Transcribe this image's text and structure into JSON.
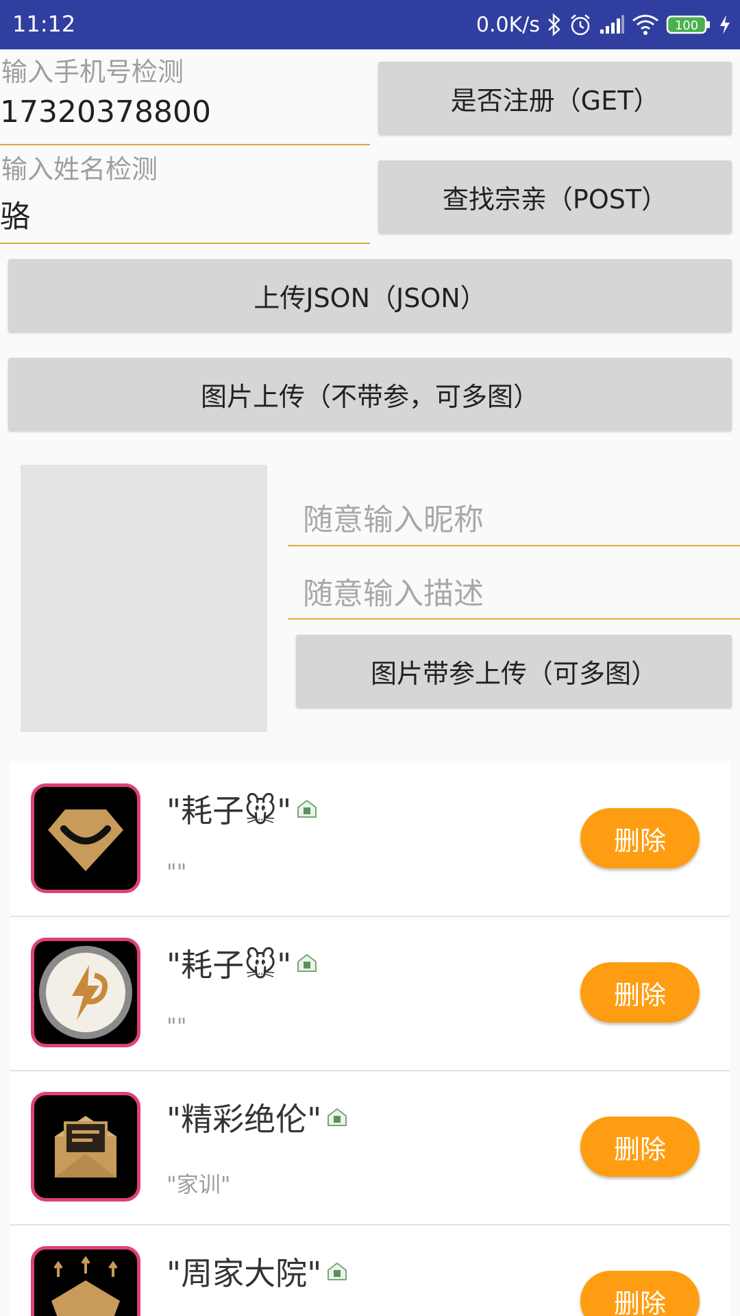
{
  "status": {
    "time": "11:12",
    "speed": "0.0K/s",
    "battery": "100"
  },
  "phone_field": {
    "label": "输入手机号检测",
    "value": "17320378800"
  },
  "name_field": {
    "label": "输入姓名检测",
    "value": "骆"
  },
  "buttons": {
    "register_check": "是否注册（GET）",
    "find_relatives": "查找宗亲（POST）",
    "upload_json": "上传JSON（JSON）",
    "image_upload": "图片上传（不带参，可多图）",
    "image_upload_params": "图片带参上传（可多图）"
  },
  "form": {
    "nickname_placeholder": "随意输入昵称",
    "description_placeholder": "随意输入描述"
  },
  "list": {
    "delete_label": "删除",
    "items": [
      {
        "name": "\"耗子🐭\"",
        "desc": "\"\"",
        "avatar_icon": "smile-shield-icon"
      },
      {
        "name": "\"耗子🐭\"",
        "desc": "\"\"",
        "avatar_icon": "lightning-p-icon"
      },
      {
        "name": "\"精彩绝伦\"",
        "desc": "\"家训\"",
        "avatar_icon": "envelope-icon"
      },
      {
        "name": "\"周家大院\"",
        "desc": "",
        "avatar_icon": "house-icon"
      }
    ]
  },
  "colors": {
    "statusbar": "#303f9f",
    "accent_underline": "#e0a93a",
    "delete_button": "#ff9d12",
    "avatar_border": "#e0407a"
  }
}
